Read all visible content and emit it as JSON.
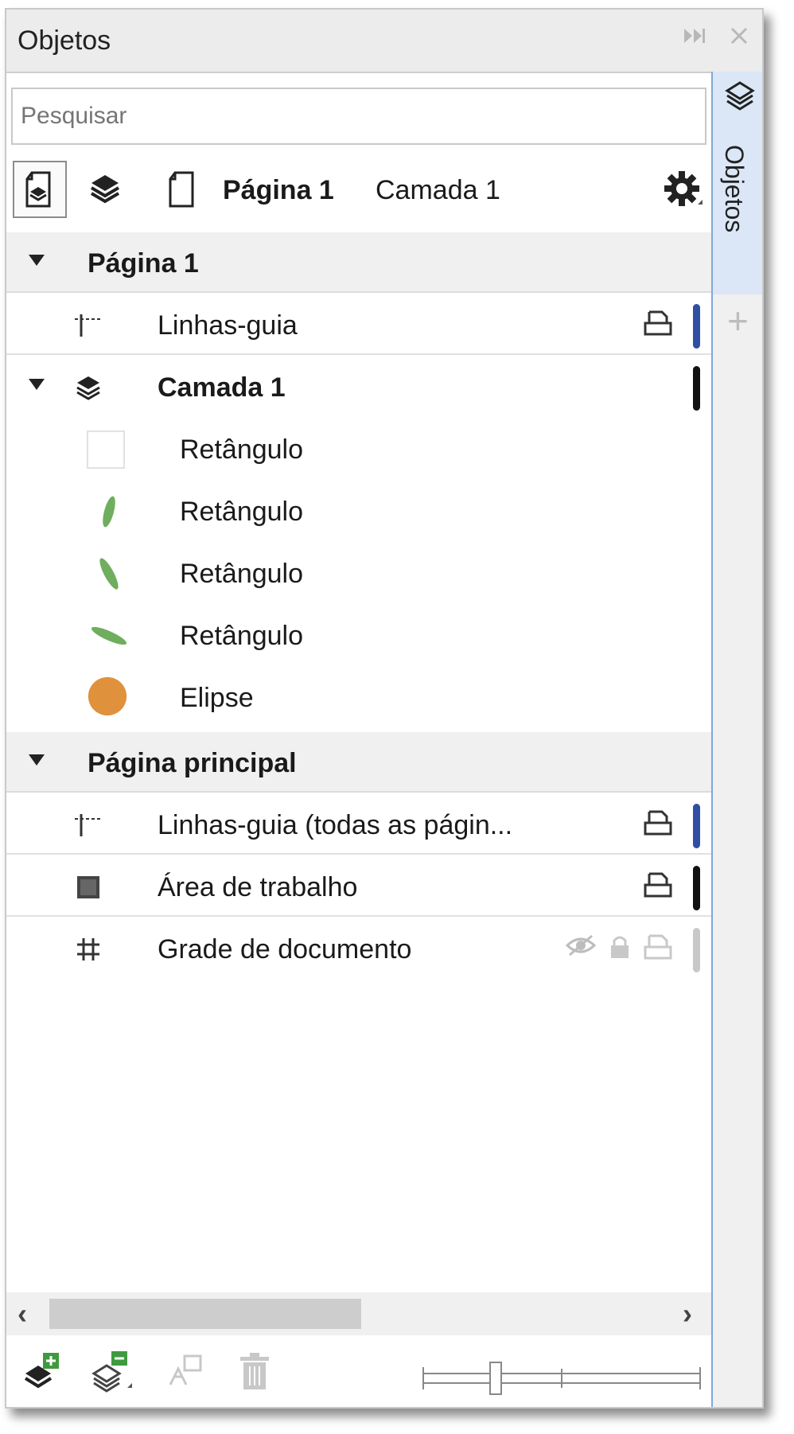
{
  "panel": {
    "title": "Objetos",
    "side_tab_label": "Objetos"
  },
  "search": {
    "placeholder": "Pesquisar"
  },
  "toolbar": {
    "page_label": "Página 1",
    "layer_label": "Camada 1"
  },
  "tree": {
    "page1": {
      "label": "Página 1",
      "guides": "Linhas-guia",
      "layer": "Camada 1",
      "objects": [
        "Retângulo",
        "Retângulo",
        "Retângulo",
        "Retângulo",
        "Elipse"
      ]
    },
    "master": {
      "label": "Página principal",
      "guides": "Linhas-guia (todas as págin...",
      "desktop": "Área de trabalho",
      "grid": "Grade de documento"
    }
  },
  "colors": {
    "guides_color": "#2e4fa3",
    "layer_color": "#111111",
    "ellipse_fill": "#e0913c",
    "leaf_fill": "#6fae5e",
    "grid_color": "#c8c8c8"
  }
}
